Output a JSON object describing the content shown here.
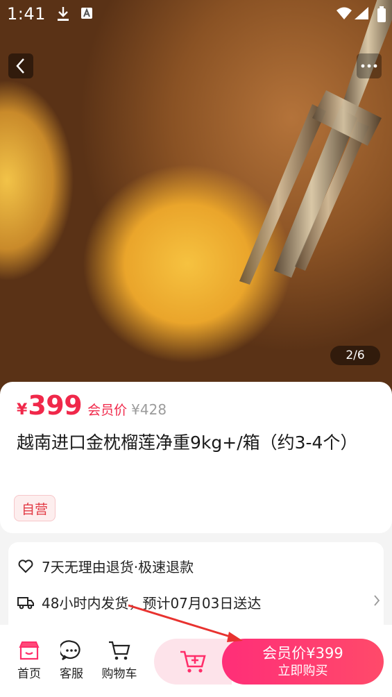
{
  "status_bar": {
    "time": "1:41"
  },
  "gallery": {
    "counter": "2/6"
  },
  "product": {
    "currency": "¥",
    "price": "399",
    "member_label": "会员价",
    "original_price": "¥428",
    "title": "越南进口金枕榴莲净重9kg+/箱（约3-4个）",
    "tag": "自营"
  },
  "services": {
    "returns": "7天无理由退货·极速退款",
    "shipping": "48小时内发货，预计07月03日送达"
  },
  "bottom_nav": {
    "home": "首页",
    "customer_service": "客服",
    "cart": "购物车"
  },
  "buy_button": {
    "price_line": "会员价¥399",
    "action_line": "立即购买"
  },
  "colors": {
    "accent": "#f0284a",
    "buy_gradient_start": "#ff2e78",
    "buy_gradient_end": "#ff4a6a",
    "annotation_arrow": "#e8322f"
  },
  "icons": {
    "back": "chevron-left-icon",
    "more": "more-dots-icon",
    "returns": "heart-icon",
    "shipping": "truck-icon",
    "home": "storefront-icon",
    "service": "chat-bubble-icon",
    "cart": "cart-icon",
    "add_cart": "cart-plus-icon"
  }
}
